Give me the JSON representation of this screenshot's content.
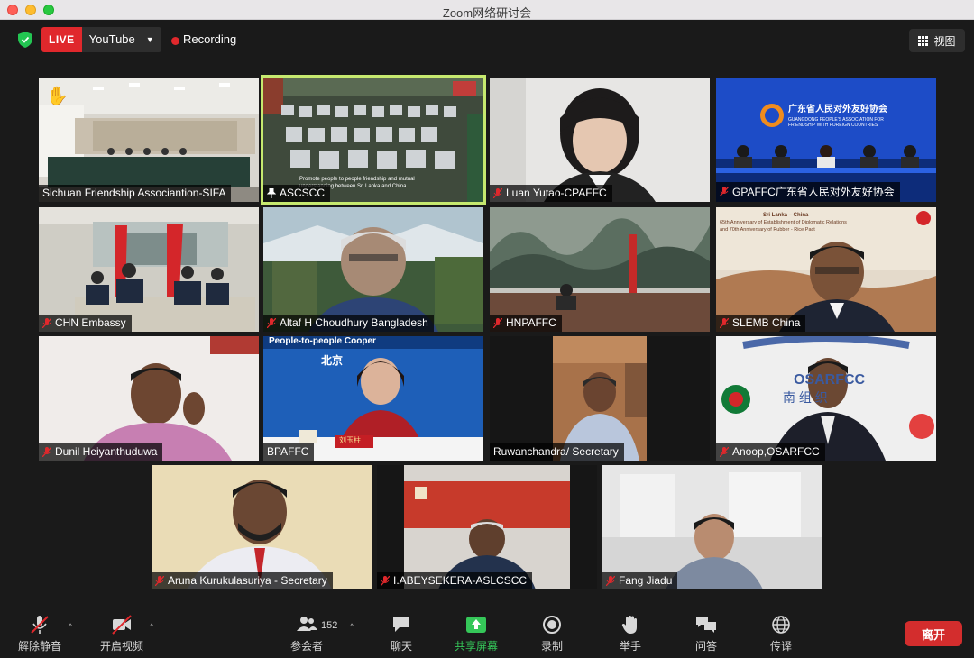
{
  "window": {
    "title": "Zoom网络研讨会"
  },
  "topbar": {
    "live_label": "LIVE",
    "platform": "YouTube",
    "recording_label": "Recording",
    "view_label": "视图"
  },
  "participants": [
    {
      "name": "Sichuan Friendship Associantion-SIFA",
      "muted": false,
      "hand_raised": true
    },
    {
      "name": "ASCSCC",
      "muted": false,
      "pinned": true,
      "active_speaker": true,
      "banner_line1": "Promote people to people friendship and mutual",
      "banner_line2": "understanding between Sri Lanka and China"
    },
    {
      "name": "Luan Yutao-CPAFFC",
      "muted": true
    },
    {
      "name": "GPAFFC广东省人民对外友好协会",
      "muted": true,
      "banner_title": "广东省人民对外友好协会",
      "banner_subtitle": "GUANGDONG PEOPLE'S ASSOCIATION FOR FRIENDSHIP WITH FOREIGN COUNTRIES"
    },
    {
      "name": "CHN Embassy",
      "muted": true
    },
    {
      "name": "Altaf H Choudhury Bangladesh",
      "muted": true
    },
    {
      "name": "HNPAFFC",
      "muted": true
    },
    {
      "name": "SLEMB China",
      "muted": true,
      "banner_line1": "Sri Lanka – China",
      "banner_line2": "65th Anniversary of Establishment of Diplomatic Relations",
      "banner_line3": "and 70th Anniversary of Rubber - Rice Pact"
    },
    {
      "name": "Dunil Heiyanthuduwa",
      "muted": true
    },
    {
      "name": "BPAFFC",
      "muted": false,
      "banner_line1": "People-to-people Cooper",
      "banner_city": "北京",
      "nameplate": "刘玉柱"
    },
    {
      "name": "Ruwanchandra/ Secretary",
      "muted": false
    },
    {
      "name": "Anoop,OSARFCC",
      "muted": true,
      "banner_text": "OSARFCC",
      "banner_cn": "南 组 织"
    },
    {
      "name": "Aruna Kurukulasuriya - Secretary",
      "muted": true
    },
    {
      "name": "I.ABEYSEKERA-ASLCSCC",
      "muted": true
    },
    {
      "name": "Fang Jiadu",
      "muted": true
    }
  ],
  "toolbar": {
    "unmute_label": "解除静音",
    "video_label": "开启视频",
    "participants_label": "参会者",
    "participants_count": "152",
    "chat_label": "聊天",
    "share_label": "共享屏幕",
    "record_label": "录制",
    "raise_hand_label": "举手",
    "qa_label": "问答",
    "interpret_label": "传译",
    "leave_label": "离开"
  },
  "colors": {
    "accent_green": "#35c759",
    "live_red": "#e0282c",
    "active_border": "#c6e96f",
    "leave_red": "#d32d2d"
  }
}
